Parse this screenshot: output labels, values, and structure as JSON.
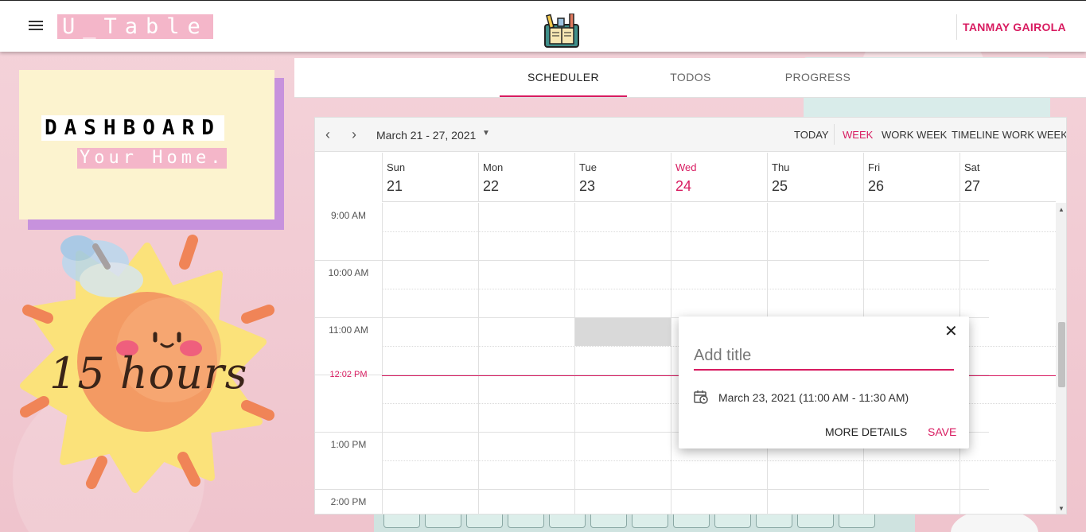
{
  "app": {
    "title": "U_Table",
    "user_name": "TANMAY GAIROLA"
  },
  "dashboard": {
    "title": "DASHBOARD",
    "subtitle": "Your Home.",
    "hours_text": "15 hours"
  },
  "tabs": [
    {
      "label": "SCHEDULER",
      "active": true
    },
    {
      "label": "TODOS",
      "active": false
    },
    {
      "label": "PROGRESS",
      "active": false
    }
  ],
  "scheduler": {
    "date_range": "March 21 - 27, 2021",
    "views": [
      {
        "label": "TODAY",
        "active": false
      },
      {
        "label": "WEEK",
        "active": true
      },
      {
        "label": "WORK WEEK",
        "active": false
      },
      {
        "label": "TIMELINE WORK WEEK",
        "active": false
      }
    ],
    "days": [
      {
        "name": "Sun",
        "num": "21",
        "today": false
      },
      {
        "name": "Mon",
        "num": "22",
        "today": false
      },
      {
        "name": "Tue",
        "num": "23",
        "today": false
      },
      {
        "name": "Wed",
        "num": "24",
        "today": true
      },
      {
        "name": "Thu",
        "num": "25",
        "today": false
      },
      {
        "name": "Fri",
        "num": "26",
        "today": false
      },
      {
        "name": "Sat",
        "num": "27",
        "today": false
      }
    ],
    "times": [
      "9:00 AM",
      "10:00 AM",
      "11:00 AM",
      "1:00 PM",
      "2:00 PM"
    ],
    "current_time": "12:02 PM"
  },
  "popup": {
    "title_placeholder": "Add title",
    "date_text": "March 23, 2021 (11:00 AM - 11:30 AM)",
    "more_label": "MORE DETAILS",
    "save_label": "SAVE"
  },
  "colors": {
    "accent": "#d81b60",
    "title_bg": "#f4b6c9",
    "card_bg": "#fcf3cf",
    "card_shadow": "#c792dd"
  }
}
